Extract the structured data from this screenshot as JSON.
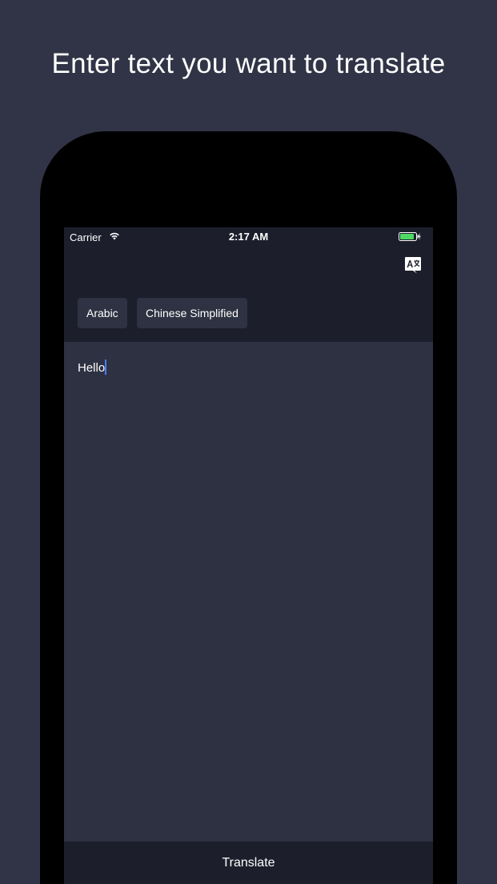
{
  "headline": "Enter text you want to translate",
  "status_bar": {
    "carrier": "Carrier",
    "time": "2:17 AM",
    "battery_color": "#4cd964"
  },
  "nav": {
    "translate_icon": "translate-icon"
  },
  "languages": {
    "from": "Arabic",
    "to": "Chinese Simplified"
  },
  "input": {
    "value": "Hello"
  },
  "footer": {
    "translate_label": "Translate"
  },
  "colors": {
    "background": "#313446",
    "bar": "#1c1f2b",
    "content": "#2e3142",
    "caret": "#4a7cff"
  }
}
